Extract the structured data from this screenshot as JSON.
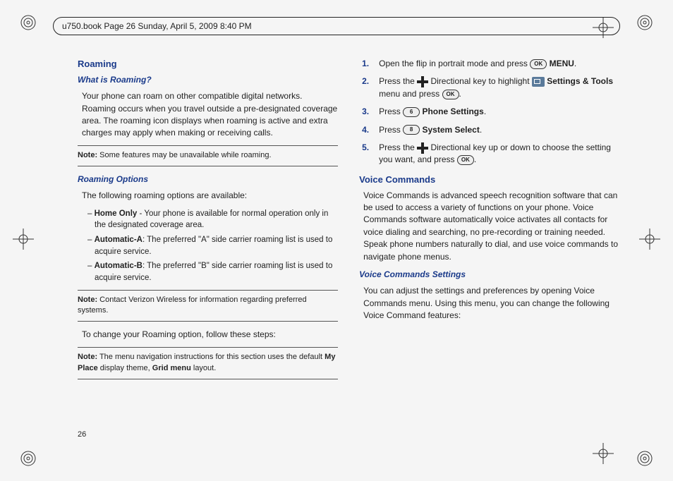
{
  "header": {
    "text": "u750.book  Page 26  Sunday, April 5, 2009  8:40 PM"
  },
  "pageNumber": "26",
  "leftCol": {
    "h1": "Roaming",
    "h2a": "What is Roaming?",
    "p1": "Your phone can roam on other compatible digital networks. Roaming occurs when you travel outside a pre-designated coverage area. The roaming icon displays when roaming is active and extra charges may apply when making or receiving calls.",
    "note1": {
      "label": "Note:",
      "text": " Some features may be unavailable while roaming."
    },
    "h2b": "Roaming Options",
    "p2": "The following roaming options are available:",
    "opts": [
      {
        "name": "Home Only",
        "desc": " - Your phone is available for normal operation only in the designated coverage area."
      },
      {
        "name": "Automatic-A",
        "desc": ": The preferred \"A\" side carrier roaming list is used to acquire service."
      },
      {
        "name": "Automatic-B",
        "desc": ": The preferred \"B\" side carrier roaming list is used to acquire service."
      }
    ],
    "note2": {
      "label": "Note:",
      "text": " Contact Verizon Wireless for information regarding preferred systems."
    },
    "p3": "To change your Roaming option, follow these steps:",
    "note3": {
      "label": "Note:",
      "textA": " The menu navigation instructions for this section uses the default ",
      "bold1": "My Place",
      "textB": " display theme, ",
      "bold2": "Grid menu",
      "textC": " layout."
    }
  },
  "rightCol": {
    "steps": [
      {
        "a": "Open the flip in portrait mode and press ",
        "key1": "OK",
        "b": " ",
        "bold1": "MENU",
        "c": "."
      },
      {
        "a": "Press the ",
        "dpad": true,
        "b": " Directional key to highlight ",
        "icon": true,
        "bold1": " Settings & Tools",
        "c": " menu and press ",
        "key1": "OK",
        "d": "."
      },
      {
        "a": "Press ",
        "key1": "6",
        "b": " ",
        "bold1": "Phone Settings",
        "c": "."
      },
      {
        "a": "Press ",
        "key1": "8",
        "b": " ",
        "bold1": "System Select",
        "c": "."
      },
      {
        "a": "Press the ",
        "dpad": true,
        "b": " Directional key up or down to choose the setting you want, and press ",
        "key1": "OK",
        "c": "."
      }
    ],
    "h1": "Voice Commands",
    "p1": "Voice Commands is advanced speech recognition software that can be used to access a  variety of functions on your phone. Voice Commands software automatically voice activates all contacts for voice dialing and searching, no pre-recording or training needed. Speak phone numbers naturally to dial, and use voice commands to navigate phone menus.",
    "h2": "Voice Commands Settings",
    "p2": "You can adjust the settings and preferences by opening Voice Commands menu. Using this menu, you can change the following Voice Command features:"
  }
}
